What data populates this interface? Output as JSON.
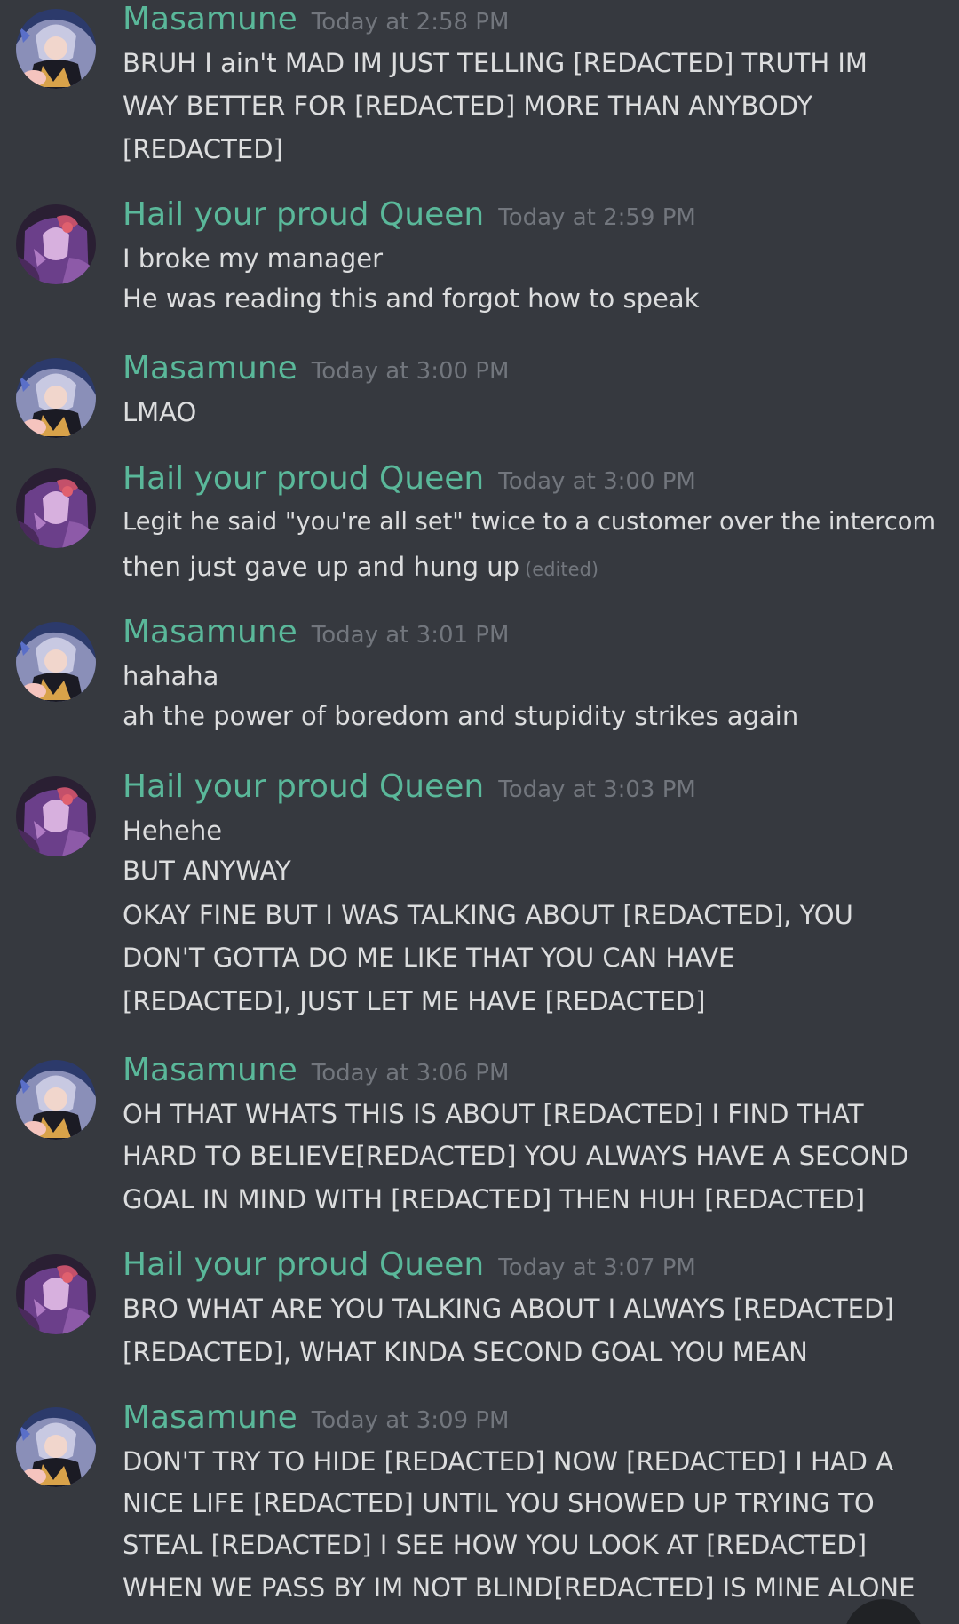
{
  "messages": [
    {
      "author": "Masamune",
      "timestamp": "Today at 2:58 PM",
      "avatar": "masamune-avatar",
      "lines": [
        "BRUH I ain't MAD IM JUST TELLING [REDACTED] TRUTH IM",
        "WAY BETTER FOR [REDACTED] MORE THAN ANYBODY",
        "[REDACTED]"
      ]
    },
    {
      "author": "Hail your proud Queen",
      "timestamp": "Today at 2:59 PM",
      "avatar": "queen-avatar",
      "lines": [
        "I broke my manager",
        "He was reading this and forgot how to speak"
      ]
    },
    {
      "author": "Masamune",
      "timestamp": "Today at 3:00 PM",
      "avatar": "masamune-avatar",
      "lines": [
        "LMAO"
      ]
    },
    {
      "author": "Hail your proud Queen",
      "timestamp": "Today at 3:00 PM",
      "avatar": "queen-avatar",
      "lines": [
        "Legit he said \"you're all set\" twice to a customer over the intercom",
        "then just gave up and hung up"
      ],
      "edited_label": "(edited)"
    },
    {
      "author": "Masamune",
      "timestamp": "Today at 3:01 PM",
      "avatar": "masamune-avatar",
      "lines": [
        "hahaha",
        "ah the power of boredom and stupidity strikes again"
      ]
    },
    {
      "author": "Hail your proud Queen",
      "timestamp": "Today at 3:03 PM",
      "avatar": "queen-avatar",
      "lines": [
        "Hehehe",
        "BUT ANYWAY",
        "OKAY FINE BUT I WAS TALKING ABOUT [REDACTED], YOU",
        "DON'T GOTTA DO ME LIKE THAT YOU CAN HAVE",
        "[REDACTED], JUST LET ME HAVE [REDACTED]"
      ]
    },
    {
      "author": "Masamune",
      "timestamp": "Today at 3:06 PM",
      "avatar": "masamune-avatar",
      "lines": [
        "OH THAT WHATS THIS IS ABOUT [REDACTED] I FIND THAT",
        "HARD TO BELIEVE[REDACTED] YOU ALWAYS HAVE A SECOND",
        "GOAL IN MIND WITH [REDACTED] THEN HUH [REDACTED]"
      ]
    },
    {
      "author": "Hail your proud Queen",
      "timestamp": "Today at 3:07 PM",
      "avatar": "queen-avatar",
      "lines": [
        "BRO WHAT ARE YOU TALKING ABOUT I ALWAYS [REDACTED]",
        "[REDACTED], WHAT KINDA SECOND GOAL YOU MEAN"
      ]
    },
    {
      "author": "Masamune",
      "timestamp": "Today at 3:09 PM",
      "avatar": "masamune-avatar",
      "lines": [
        "DON'T TRY TO HIDE [REDACTED] NOW [REDACTED] I HAD A",
        "NICE LIFE [REDACTED] UNTIL YOU SHOWED UP TRYING TO",
        "STEAL [REDACTED] I SEE HOW YOU LOOK AT [REDACTED]",
        "WHEN WE PASS BY IM NOT BLIND[REDACTED] IS MINE ALONE"
      ]
    }
  ],
  "colors": {
    "background": "#36393f",
    "username": "#5ab89a",
    "message_text": "#dcddde",
    "muted": "#72767d"
  }
}
